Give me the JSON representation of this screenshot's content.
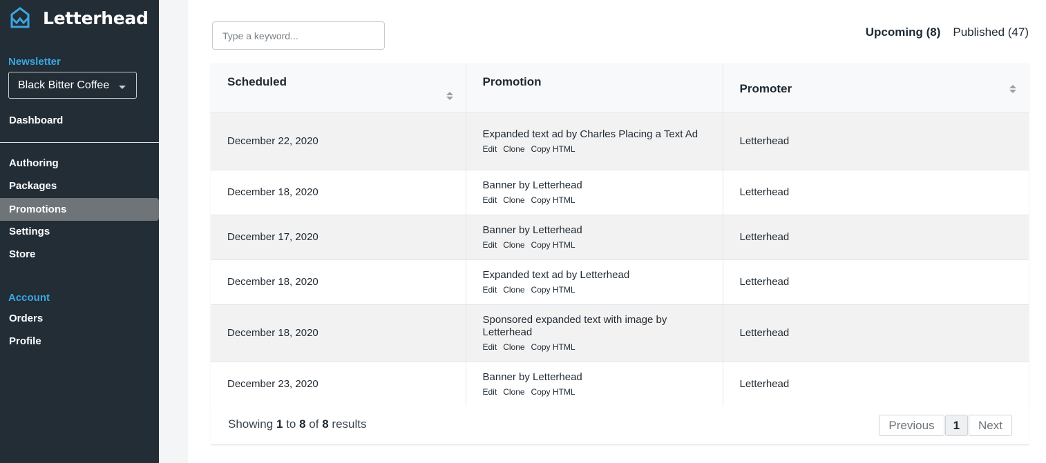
{
  "brand": {
    "name": "Letterhead",
    "accent": "#3ba6e0",
    "logo_icon": "crown-mountain-icon"
  },
  "sidebar": {
    "newsletter_label": "Newsletter",
    "newsletter_selected": "Black Bitter Coffee",
    "dashboard": "Dashboard",
    "items": [
      "Authoring",
      "Packages",
      "Promotions",
      "Settings",
      "Store"
    ],
    "active_item": "Promotions",
    "account_label": "Account",
    "account_items": [
      "Orders",
      "Profile"
    ]
  },
  "search": {
    "placeholder": "Type a keyword...",
    "value": ""
  },
  "tabs": [
    {
      "label": "Upcoming (8)",
      "active": true
    },
    {
      "label": "Published (47)",
      "active": false
    }
  ],
  "table": {
    "columns": [
      "Scheduled",
      "Promotion",
      "Promoter"
    ],
    "rows": [
      {
        "scheduled": "December 22, 2020",
        "promotion": "Expanded text ad by Charles Placing a Text Ad",
        "promoter": "Letterhead"
      },
      {
        "scheduled": "December 18, 2020",
        "promotion": "Banner by Letterhead",
        "promoter": "Letterhead"
      },
      {
        "scheduled": "December 17, 2020",
        "promotion": "Banner by Letterhead",
        "promoter": "Letterhead"
      },
      {
        "scheduled": "December 18, 2020",
        "promotion": "Expanded text ad by Letterhead",
        "promoter": "Letterhead"
      },
      {
        "scheduled": "December 18, 2020",
        "promotion": "Sponsored expanded text with image by Letterhead",
        "promoter": "Letterhead"
      },
      {
        "scheduled": "December 23, 2020",
        "promotion": "Banner by Letterhead",
        "promoter": "Letterhead"
      }
    ],
    "row_actions": [
      "Edit",
      "Clone",
      "Copy HTML"
    ]
  },
  "footer": {
    "showing_prefix": "Showing",
    "from": "1",
    "to_word": "to",
    "to": "8",
    "of_word": "of",
    "total": "8",
    "suffix": "results",
    "previous": "Previous",
    "current_page": "1",
    "next": "Next"
  }
}
